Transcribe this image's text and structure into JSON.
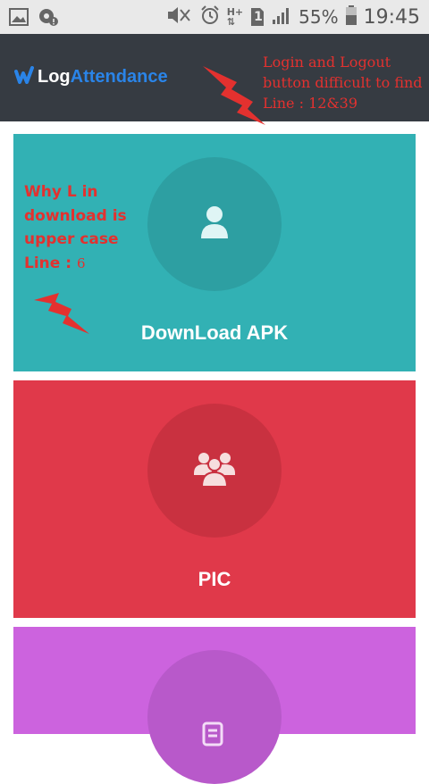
{
  "status_bar": {
    "battery_percent": "55%",
    "time": "19:45",
    "network_label": "H+",
    "sim_slot": "1",
    "icons": [
      "image-icon",
      "settings-notification-icon",
      "mute-icon",
      "alarm-icon",
      "network-icon",
      "sim-icon",
      "signal-icon",
      "battery-icon"
    ]
  },
  "header": {
    "brand_part1": "Log",
    "brand_part2": "Attendance",
    "brand_color": "#2a84e8",
    "background": "#363b42"
  },
  "annotations": {
    "header_note": "Login and Logout button difficult to find Line : 12&39",
    "card_note_text": "Why L in download is upper case Line :",
    "card_note_number": "6",
    "color": "#e3312f"
  },
  "cards": [
    {
      "label": "DownLoad APK",
      "icon": "user-icon",
      "color": "#32b1b4"
    },
    {
      "label": "PIC",
      "icon": "group-icon",
      "color": "#e0394a"
    },
    {
      "label": "",
      "icon": "document-icon",
      "color": "#cc63de"
    }
  ]
}
